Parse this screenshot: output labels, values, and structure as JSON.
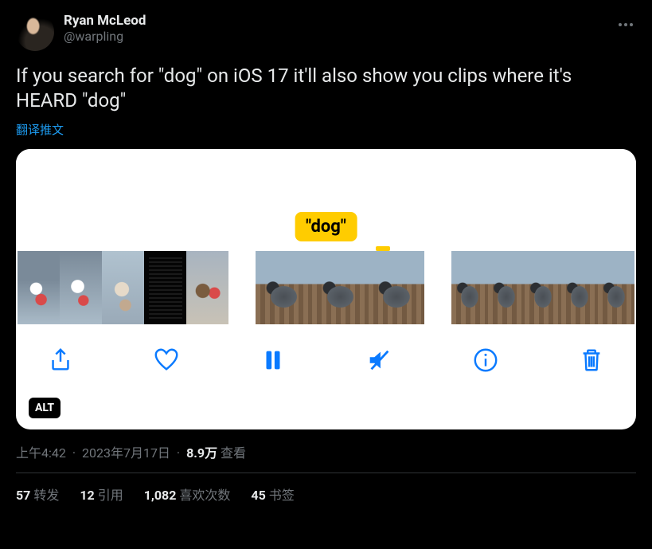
{
  "user": {
    "display_name": "Ryan McLeod",
    "handle": "@warpling"
  },
  "tweet_text": "If you search for \"dog\" on iOS 17 it'll also show you clips where it's HEARD \"dog\"",
  "translate_label": "翻译推文",
  "media": {
    "keyword_chip": "\"dog\"",
    "alt_badge": "ALT"
  },
  "meta": {
    "time": "上午4:42",
    "date": "2023年7月17日",
    "views_count": "8.9万",
    "views_label": "查看"
  },
  "stats": {
    "retweets_count": "57",
    "retweets_label": "转发",
    "quotes_count": "12",
    "quotes_label": "引用",
    "likes_count": "1,082",
    "likes_label": "喜欢次数",
    "bookmarks_count": "45",
    "bookmarks_label": "书签"
  }
}
